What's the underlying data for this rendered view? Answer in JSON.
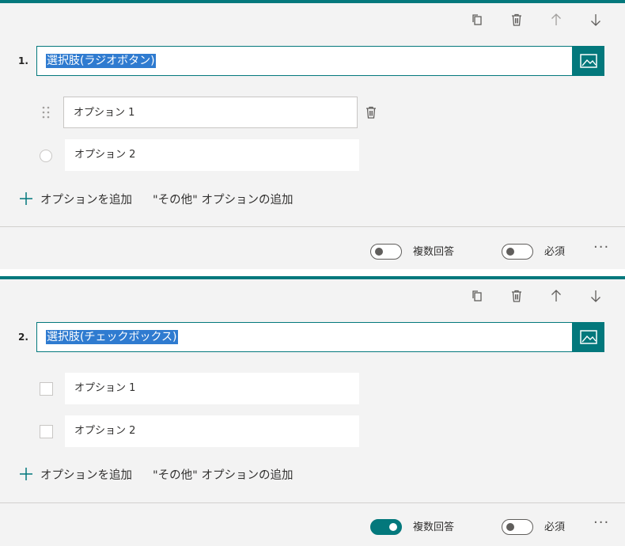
{
  "colors": {
    "accent": "#03787c",
    "selection": "#2f7bd0"
  },
  "toolbar_icons": [
    "copy-icon",
    "trash-icon",
    "arrow-up-icon",
    "arrow-down-icon"
  ],
  "questions": [
    {
      "number": "1.",
      "title": "選択肢(ラジオボタン)",
      "type": "radio",
      "options": [
        "オプション 1",
        "オプション 2"
      ],
      "add_option": "オプションを追加",
      "add_other": "\"その他\" オプションの追加",
      "multiple_answers": {
        "label": "複数回答",
        "on": false
      },
      "required": {
        "label": "必須",
        "on": false
      },
      "more": "···"
    },
    {
      "number": "2.",
      "title": "選択肢(チェックボックス)",
      "type": "checkbox",
      "options": [
        "オプション 1",
        "オプション 2"
      ],
      "add_option": "オプションを追加",
      "add_other": "\"その他\" オプションの追加",
      "multiple_answers": {
        "label": "複数回答",
        "on": true
      },
      "required": {
        "label": "必須",
        "on": false
      },
      "more": "···"
    }
  ]
}
